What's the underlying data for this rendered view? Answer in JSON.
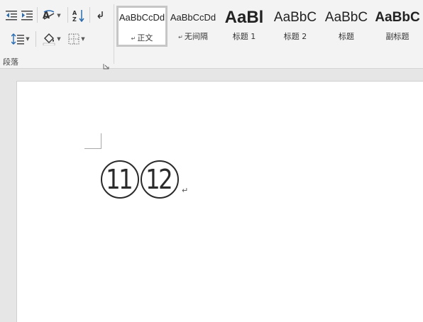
{
  "paragraph_group": {
    "label": "段落",
    "tools": [
      {
        "name": "decrease-indent",
        "icon": "outdent-icon"
      },
      {
        "name": "increase-indent",
        "icon": "indent-icon"
      },
      {
        "name": "chinese-layout",
        "icon": "chinese-layout-icon"
      },
      {
        "name": "sort",
        "icon": "sort-icon"
      },
      {
        "name": "show-paragraph-marks",
        "icon": "pilcrow-icon"
      },
      {
        "name": "line-spacing",
        "icon": "line-spacing-icon"
      },
      {
        "name": "shading",
        "icon": "paint-bucket-icon"
      },
      {
        "name": "borders",
        "icon": "borders-icon"
      }
    ]
  },
  "styles": [
    {
      "preview": "AaBbCcDd",
      "name": "正文",
      "marker": "↵",
      "selected": true
    },
    {
      "preview": "AaBbCcDd",
      "name": "无间隔",
      "marker": "↵",
      "selected": false
    },
    {
      "preview": "AaBl",
      "name": "标题 1",
      "marker": "",
      "selected": false
    },
    {
      "preview": "AaBbC",
      "name": "标题 2",
      "marker": "",
      "selected": false
    },
    {
      "preview": "AaBbC",
      "name": "标题",
      "marker": "",
      "selected": false
    },
    {
      "preview": "AaBbC",
      "name": "副标题",
      "marker": "",
      "selected": false
    }
  ],
  "document": {
    "circled_numbers": [
      "11",
      "12"
    ],
    "paragraph_mark": "↵"
  },
  "colors": {
    "ribbon_bg": "#f3f3f3",
    "canvas_bg": "#e6e6e6",
    "page_bg": "#ffffff",
    "selected_style_border": "#c6c6c6"
  }
}
